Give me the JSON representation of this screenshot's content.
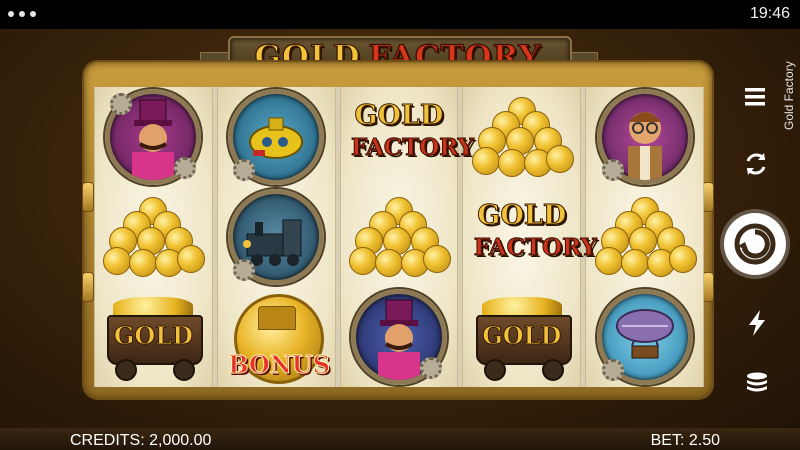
{
  "status_bar": {
    "time": "19:46"
  },
  "logo": {
    "word1": "GOLD",
    "word2": "FACTORY"
  },
  "sidebar": {
    "game_title": "Gold Factory"
  },
  "reels": [
    [
      "ringmaster",
      "coins",
      "cart"
    ],
    [
      "submarine",
      "locomotive",
      "bonus"
    ],
    [
      "gold-factory",
      "coins",
      "ringmaster"
    ],
    [
      "coins",
      "gold-factory",
      "cart"
    ],
    [
      "inventor",
      "coins",
      "airship"
    ]
  ],
  "symbols": {
    "gf_gold": "GOLD",
    "gf_factory": "FACTORY",
    "cart_label": "GOLD",
    "bonus_label": "BONUS"
  },
  "bottom_bar": {
    "credits": "CREDITS: 2,000.00",
    "bet": "BET: 2.50"
  },
  "colors": {
    "gold": "#f2c23a",
    "factory_red": "#d8361c",
    "frame_brass": "#c79b3d"
  },
  "icons": [
    "menu-icon",
    "autoplay-icon",
    "spin-icon",
    "turbo-icon",
    "bet-stack-icon"
  ]
}
